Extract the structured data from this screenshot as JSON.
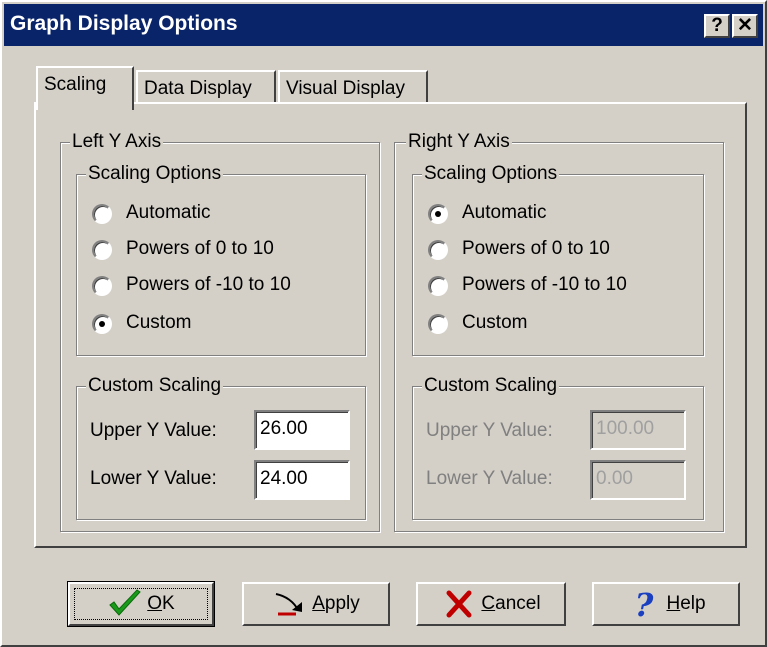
{
  "window": {
    "title": "Graph Display Options",
    "help_glyph": "?",
    "close_glyph": "✕"
  },
  "tabs": [
    {
      "label": "Scaling",
      "active": true
    },
    {
      "label": "Data Display",
      "active": false
    },
    {
      "label": "Visual Display",
      "active": false
    }
  ],
  "left_axis": {
    "title": "Left Y Axis",
    "scaling_title": "Scaling Options",
    "options": [
      "Automatic",
      "Powers of 0 to 10",
      "Powers of -10 to 10",
      "Custom"
    ],
    "selected": "Custom",
    "custom_title": "Custom Scaling",
    "upper_label": "Upper Y Value:",
    "upper_value": "26.00",
    "lower_label": "Lower Y Value:",
    "lower_value": "24.00",
    "fields_enabled": true
  },
  "right_axis": {
    "title": "Right Y Axis",
    "scaling_title": "Scaling Options",
    "options": [
      "Automatic",
      "Powers of 0 to 10",
      "Powers of -10 to 10",
      "Custom"
    ],
    "selected": "Automatic",
    "custom_title": "Custom Scaling",
    "upper_label": "Upper Y Value:",
    "upper_value": "100.00",
    "lower_label": "Lower Y Value:",
    "lower_value": "0.00",
    "fields_enabled": false
  },
  "buttons": {
    "ok": {
      "mnemonic": "O",
      "rest": "K",
      "icon": "checkmark-icon"
    },
    "apply": {
      "mnemonic": "A",
      "rest": "pply",
      "icon": "apply-arrow-icon"
    },
    "cancel": {
      "mnemonic": "C",
      "rest": "ancel",
      "icon": "red-x-icon"
    },
    "help": {
      "mnemonic": "H",
      "rest": "elp",
      "icon": "question-mark-icon"
    }
  },
  "colors": {
    "title_bar": "#0a246a",
    "face": "#d4d0c8",
    "check_green": "#1a9a1a",
    "cancel_red": "#c00000",
    "help_blue": "#1a3fc0"
  }
}
